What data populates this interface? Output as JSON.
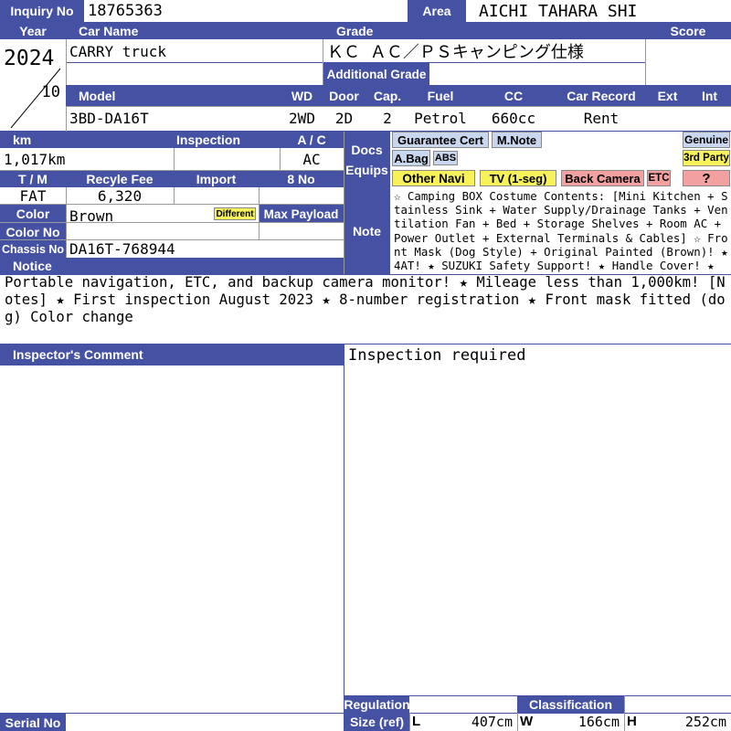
{
  "labels": {
    "inquiry_no": "Inquiry No",
    "area": "Area",
    "year": "Year",
    "car_name": "Car Name",
    "grade": "Grade",
    "score": "Score",
    "additional_grade": "Additional Grade",
    "model": "Model",
    "wd": "WD",
    "door": "Door",
    "cap": "Cap.",
    "fuel": "Fuel",
    "cc": "CC",
    "car_record": "Car Record",
    "ext": "Ext",
    "int": "Int",
    "km": "km",
    "inspection": "Inspection",
    "ac": "A / C",
    "docs": "Docs",
    "equips": "Equips",
    "tm": "T / M",
    "recycle_fee": "Recyle Fee",
    "import": "Import",
    "no8": "8 No",
    "color": "Color",
    "max_payload": "Max Payload",
    "color_no": "Color No",
    "note": "Note",
    "chassis_no": "Chassis No",
    "notice": "Notice",
    "inspector_comment": "Inspector's Comment",
    "regulation": "Regulation",
    "classification": "Classification",
    "size_ref": "Size (ref)",
    "serial_no": "Serial No",
    "L": "L",
    "W": "W",
    "H": "H"
  },
  "values": {
    "inquiry_no": "18765363",
    "area": "AICHI TAHARA SHI",
    "year": "2024",
    "month": "10",
    "car_name": "CARRY truck",
    "grade": "ＫＣ ＡＣ／ＰＳキャンピング仕様",
    "model": "3BD-DA16T",
    "wd": "2WD",
    "door": "2D",
    "cap": "2",
    "fuel": "Petrol",
    "cc": "660cc",
    "car_record": "Rent",
    "km": "1,017km",
    "ac": "AC",
    "tm": "FAT",
    "recycle_fee": "6,320",
    "color": "Brown",
    "color_different": "Different",
    "chassis_no": "DA16T-768944",
    "note": "☆ Camping BOX Costume Contents: [Mini Kitchen + Stainless Sink + Water Supply/Drainage Tanks + Ventilation Fan + Bed + Storage Shelves + Room AC + Power Outlet + External Terminals & Cables] ☆ Front Mask (Dog Style) + Original Painted (Brown)! ★ 4AT! ★ SUZUKI Safety Support! ★ Handle Cover! ★",
    "notice": "Portable navigation, ETC, and backup camera monitor! ★ Mileage less than 1,000km! [Notes] ★ First inspection August 2023 ★ 8-number registration ★ Front mask fitted (dog) Color change",
    "inspector_right": "Inspection required",
    "L": "407cm",
    "W": "166cm",
    "H": "252cm"
  },
  "badges": {
    "guarantee": "Guarantee Cert",
    "mnote": "M.Note",
    "genuine": "Genuine",
    "abag": "A.Bag",
    "abs": "ABS",
    "third_party": "3rd Party",
    "other_navi": "Other Navi",
    "tv": "TV (1-seg)",
    "back_camera": "Back Camera",
    "etc": "ETC",
    "question": "?"
  }
}
